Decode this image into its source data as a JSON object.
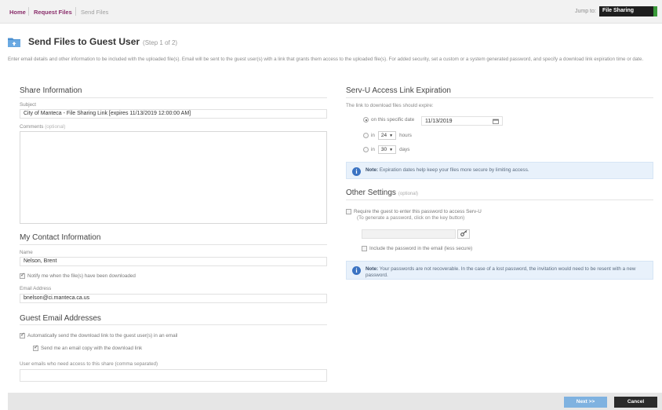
{
  "nav": {
    "home": "Home",
    "request_files": "Request Files",
    "send_files": "Send Files",
    "jump_label": "Jump to:",
    "jump_value": "File Sharing"
  },
  "page": {
    "title": "Send Files to Guest User",
    "step": "(Step 1 of 2)",
    "intro": "Enter email details and other information to be included with the uploaded file(s). Email will be sent to the guest user(s) with a link that grants them access to the uploaded file(s). For added security, set a custom or a system generated password, and specify a download link expiration time or date."
  },
  "share": {
    "title": "Share Information",
    "subject_label": "Subject",
    "subject_value": "City of Manteca - File Sharing Link [expires 11/13/2019 12:00:00 AM]",
    "comments_label": "Comments",
    "comments_optional": "(optional)"
  },
  "contact": {
    "title": "My Contact Information",
    "name_label": "Name",
    "name_value": "Nelson, Brent",
    "notify_label": "Notify me when the file(s) have been downloaded",
    "email_label": "Email Address",
    "email_value": "bnelson@ci.manteca.ca.us"
  },
  "guest": {
    "title": "Guest Email Addresses",
    "auto_send_label": "Automatically send the download link to the guest user(s) in an email",
    "copy_label": "Send me an email copy with the download link",
    "emails_label": "User emails who need access to this share (comma separated)"
  },
  "expiration": {
    "title": "Serv-U Access Link Expiration",
    "intro": "The link to download files should expire:",
    "option_date_label": "on this specific date",
    "date_value": "11/13/2019",
    "in_label": "in",
    "hours_value": "24",
    "hours_label": "hours",
    "days_value": "30",
    "days_label": "days",
    "note_bold": "Note:",
    "note_text": "Expiration dates help keep your files more secure by limiting access."
  },
  "other": {
    "title": "Other Settings",
    "optional": "(optional)",
    "require_label": "Require the guest to enter this password to access Serv-U",
    "require_hint": "(To generate a password, click on the key button)",
    "include_label": "Include the password in the email (less secure)",
    "note_bold": "Note:",
    "note_text": "Your passwords are not recoverable. In the case of a lost password, the invitation would need to be resent with a new password."
  },
  "footer": {
    "next_label": "Next >>",
    "cancel_label": "Cancel"
  }
}
